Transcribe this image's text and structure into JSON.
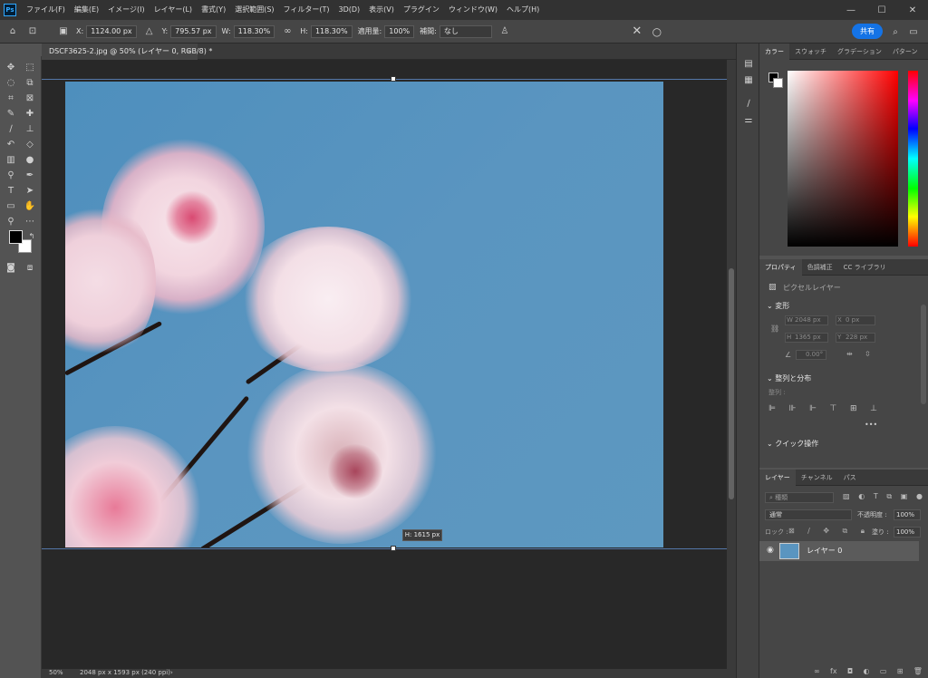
{
  "menubar": {
    "logo": "Ps",
    "items": [
      "ファイル(F)",
      "編集(E)",
      "イメージ(I)",
      "レイヤー(L)",
      "書式(Y)",
      "選択範囲(S)",
      "フィルター(T)",
      "3D(D)",
      "表示(V)",
      "プラグイン",
      "ウィンドウ(W)",
      "ヘルプ(H)"
    ],
    "window_buttons": [
      "—",
      "☐",
      "✕"
    ]
  },
  "options": {
    "x_label": "X:",
    "x_value": "1124.00 px",
    "y_label": "Y:",
    "y_value": "795.57 px",
    "w_label": "W:",
    "w_value": "118.30%",
    "h_label": "H:",
    "h_value": "118.30%",
    "angle_label": "適用量:",
    "angle_value": "100%",
    "interp_label": "補間:",
    "interp_value": "なし",
    "share_label": "共有"
  },
  "document": {
    "tab_title": "DSCF3625-2.jpg @ 50% (レイヤー 0, RGB/8) *",
    "tooltip": "H: 1615 px"
  },
  "status": {
    "zoom": "50%",
    "size": "2048 px x 1593 px (240 ppi)"
  },
  "color_panel": {
    "tabs": [
      "カラー",
      "スウォッチ",
      "グラデーション",
      "パターン"
    ]
  },
  "properties_panel": {
    "tabs": [
      "プロパティ",
      "色調補正",
      "CC ライブラリ"
    ],
    "pixel_layer": "ピクセルレイヤー",
    "transform_heading": "変形",
    "w_label": "W",
    "w_value": "2048 px",
    "x_label": "X",
    "x_value": "0 px",
    "h_label": "H",
    "h_value": "1365 px",
    "y_label": "Y",
    "y_value": "228 px",
    "angle_value": "0.00°",
    "align_heading": "整列と分布",
    "align_label": "整列 :",
    "quick_heading": "クイック操作"
  },
  "layers_panel": {
    "tabs": [
      "レイヤー",
      "チャンネル",
      "パス"
    ],
    "search_placeholder": "種類",
    "blend_mode": "通常",
    "opacity_label": "不透明度 :",
    "opacity_value": "100%",
    "lock_label": "ロック :",
    "fill_label": "塗り :",
    "fill_value": "100%",
    "layer_name": "レイヤー 0"
  },
  "colors": {
    "accent": "#1473e6",
    "sky": "#5a95c0"
  }
}
